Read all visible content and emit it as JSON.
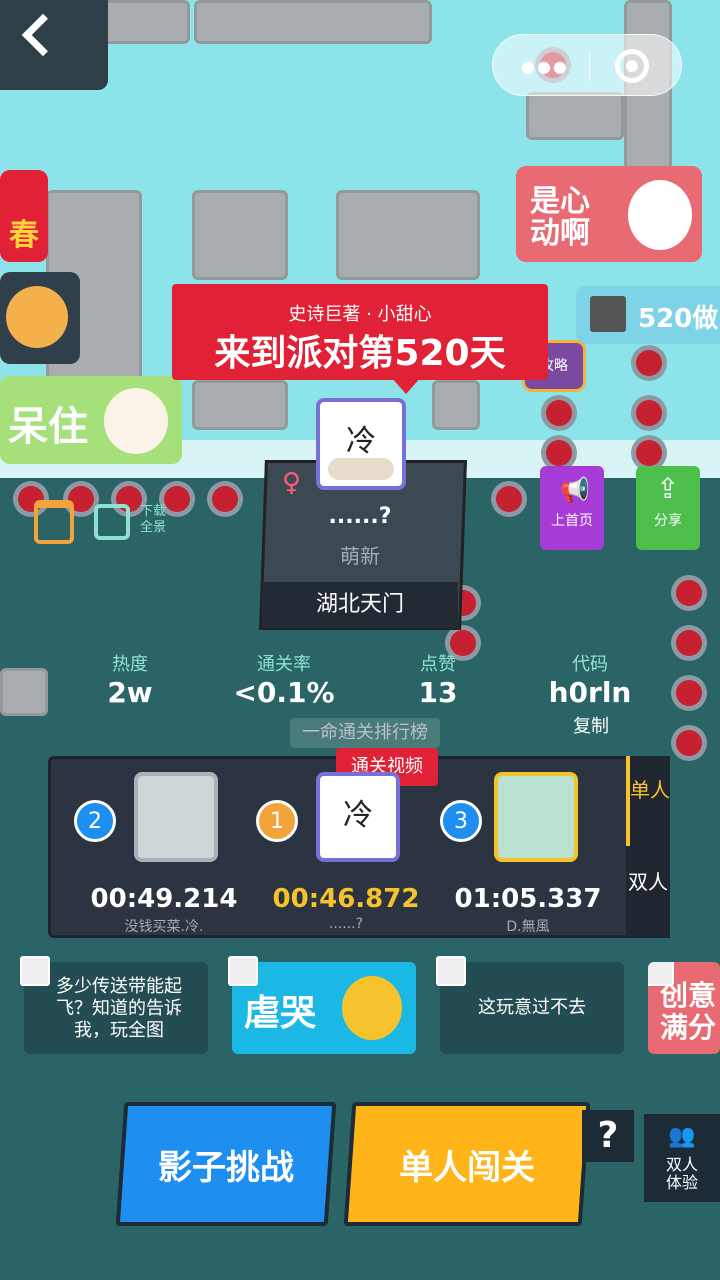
{
  "banner": {
    "subtitle": "史诗巨著 · 小甜心",
    "title": "来到派对第520天"
  },
  "stickers": {
    "left_red": "春",
    "dazed": "呆住",
    "heart": "是心动啊",
    "day520": "520做",
    "tv": "攻略"
  },
  "toolbar": {
    "download_label": "下载全景",
    "home_label": "上首页",
    "share_label": "分享"
  },
  "profile": {
    "gender_icon": "♀",
    "name": "......?",
    "level": "萌新",
    "city": "湖北天门",
    "avatar_glyph": "冷"
  },
  "stats": [
    {
      "label": "热度",
      "value": "2w"
    },
    {
      "label": "通关率",
      "value": "<0.1%"
    },
    {
      "label": "点赞",
      "value": "13"
    },
    {
      "label": "代码",
      "value": "h0rln"
    }
  ],
  "copy_label": "复制",
  "leaderboard": {
    "tab_label": "一命通关排行榜",
    "video_label": "通关视频",
    "modes": [
      "单人",
      "双人"
    ],
    "entries": [
      {
        "rank": "2",
        "time": "00:49.214",
        "name": "没钱买菜.冷."
      },
      {
        "rank": "1",
        "time": "00:46.872",
        "name": "......?"
      },
      {
        "rank": "3",
        "time": "01:05.337",
        "name": "D.無風"
      }
    ]
  },
  "comments": [
    {
      "text": "多少传送带能起飞？知道的告诉我，玩全图"
    },
    {
      "text": "虐哭"
    },
    {
      "text": "这玩意过不去"
    },
    {
      "text": "创意满分"
    }
  ],
  "actions": {
    "shadow_label": "影子挑战",
    "single_label": "单人闯关",
    "help_label": "?",
    "duo_label": "双人体验"
  }
}
